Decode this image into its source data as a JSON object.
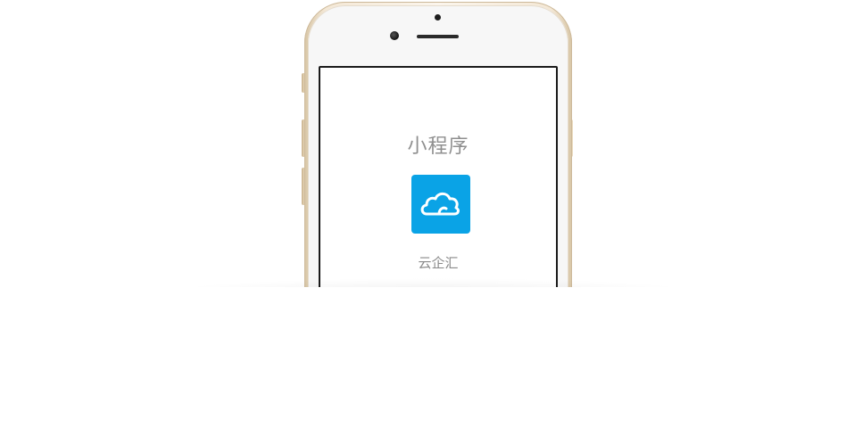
{
  "mini_program": {
    "title": "小程序",
    "app": {
      "name": "云企汇",
      "icon": "cloud-icon",
      "icon_bg_color": "#0aa3e6"
    }
  },
  "device": {
    "frame_color": "#f4e8d6"
  }
}
